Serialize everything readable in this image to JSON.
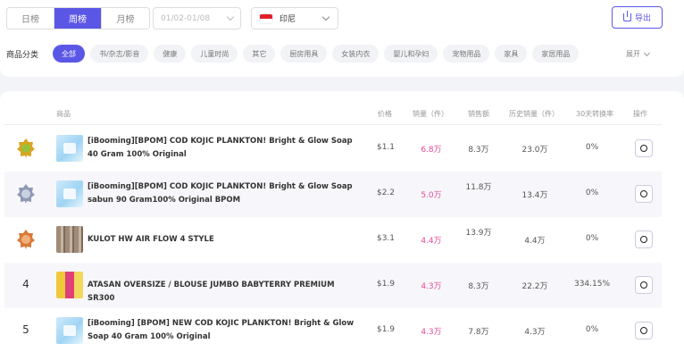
{
  "filters": {
    "periods": [
      "日榜",
      "周榜",
      "月榜"
    ],
    "active_period": "周榜",
    "date_range": "01/02-01/08",
    "country": "印尼",
    "export_label": "导出"
  },
  "categories": {
    "label": "商品分类",
    "items": [
      "全部",
      "书/杂志/影音",
      "健康",
      "儿童时尚",
      "其它",
      "厨房用具",
      "女装内衣",
      "婴儿和孕妇",
      "宠物用品",
      "家具",
      "家居用品"
    ],
    "expand_label": "展开"
  },
  "table": {
    "headers": {
      "product": "商品",
      "price": "价格",
      "sales": "销量（件）",
      "amount": "销售额",
      "history": "历史销量（件）",
      "rate": "30天转换率",
      "action": "操作"
    },
    "rows": [
      {
        "rank": "1",
        "badge": "gold",
        "name": "[iBooming][BPOM] COD KOJIC PLANKTON! Bright & Glow Soap 40 Gram 100% Original",
        "price": "$1.1",
        "sales": "6.8万",
        "amount": "8.3万",
        "history": "23.0万",
        "rate": "0%",
        "thumb": "soap"
      },
      {
        "rank": "2",
        "badge": "silver",
        "name": "[iBooming][BPOM] COD KOJIC PLANKTON! Bright & Glow Soap sabun 90 Gram100% Original BPOM",
        "price": "$2.2",
        "sales": "5.0万",
        "amount": "11.8万",
        "history": "13.4万",
        "rate": "0%",
        "thumb": "soap"
      },
      {
        "rank": "3",
        "badge": "bronze",
        "name": "KULOT HW AIR FLOW 4 STYLE",
        "price": "$3.1",
        "sales": "4.4万",
        "amount": "13.9万",
        "history": "4.4万",
        "rate": "0%",
        "thumb": "kulot"
      },
      {
        "rank": "4",
        "badge": "",
        "name": "ATASAN OVERSIZE / BLOUSE JUMBO BABYTERRY PREMIUM SR300",
        "price": "$1.9",
        "sales": "4.3万",
        "amount": "8.3万",
        "history": "22.2万",
        "rate": "334.15%",
        "thumb": "atasan"
      },
      {
        "rank": "5",
        "badge": "",
        "name": "[iBooming] [BPOM] NEW COD KOJIC PLANKTON! Bright & Glow Soap 40 Gram 100% Original",
        "price": "$1.9",
        "sales": "4.3万",
        "amount": "7.8万",
        "history": "4.3万",
        "rate": "0%",
        "thumb": "soap"
      }
    ]
  },
  "colors": {
    "accent": "#5b57e6",
    "sales_text": "#e54a9a",
    "gold": "#d9a520",
    "silver": "#8e99b3",
    "bronze": "#d97a3a"
  }
}
